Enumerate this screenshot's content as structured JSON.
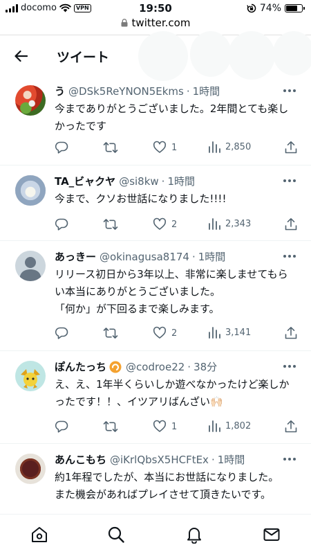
{
  "status_bar": {
    "carrier": "docomo",
    "vpn": "VPN",
    "time": "19:50",
    "battery": "74%",
    "battery_level": 0.74
  },
  "browser": {
    "url": "twitter.com"
  },
  "header": {
    "title": "ツイート"
  },
  "tweets": [
    {
      "name": "う",
      "handle": "@DSk5ReYNON5Ekms",
      "dot": "·",
      "time": "1時間",
      "text": "今までありがとうございました。2年間とても楽しかったです",
      "likes": "1",
      "views": "2,850"
    },
    {
      "name": "TA_ビャクヤ",
      "handle": "@si8kw",
      "dot": "·",
      "time": "1時間",
      "text": "今まで、クソお世話になりました!!!!",
      "likes": "2",
      "views": "2,343"
    },
    {
      "name": "あっきー",
      "handle": "@okinagusa8174",
      "dot": "·",
      "time": "1時間",
      "text": "リリース初日から3年以上、非常に楽しませてもらい本当にありがとうございました。\n「何か」が下回るまで楽しみます。",
      "likes": "2",
      "views": "3,141"
    },
    {
      "name": "ぽんたっち",
      "handle": "@codroe22",
      "dot": "·",
      "time": "38分",
      "text": "え、え、1年半くらいしか遊べなかったけど楽しかったです！！、イツアリばんざい🙌🏻",
      "likes": "1",
      "views": "1,802"
    },
    {
      "name": "あんこもち",
      "handle": "@iKrlQbsX5HCFtEx",
      "dot": "·",
      "time": "1時間",
      "text": "約1年程でしたが、本当にお世話になりました。\nまた機会があればプレイさせて頂きたいです。"
    }
  ],
  "icons": {
    "reply": "speech-bubble-icon",
    "retweet": "retweet-icon",
    "like": "heart-icon",
    "views": "bar-chart-icon",
    "share": "share-arrow-icon",
    "nav": [
      "home-icon",
      "search-icon",
      "bell-icon",
      "mail-icon"
    ]
  },
  "colors": {
    "text": "#0f1419",
    "secondary": "#536471",
    "divider": "#eff3f4"
  }
}
